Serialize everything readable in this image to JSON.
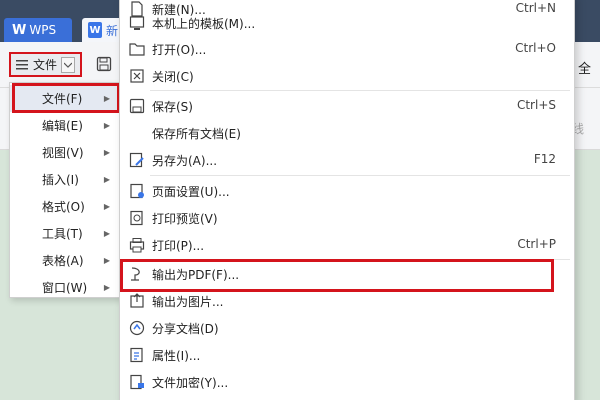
{
  "tabs": {
    "wps_label": "WPS",
    "doc_label": "新"
  },
  "toolbar": {
    "file_label": "文件",
    "right_text": "全",
    "ribbon_right_text": "线"
  },
  "left_menu": {
    "items": [
      {
        "label": "文件(F)"
      },
      {
        "label": "编辑(E)"
      },
      {
        "label": "视图(V)"
      },
      {
        "label": "插入(I)"
      },
      {
        "label": "格式(O)"
      },
      {
        "label": "工具(T)"
      },
      {
        "label": "表格(A)"
      },
      {
        "label": "窗口(W)"
      }
    ]
  },
  "file_menu": {
    "items": [
      {
        "label": "新建(N)...",
        "shortcut": "Ctrl+N",
        "icon": "new-doc-icon"
      },
      {
        "label": "本机上的模板(M)...",
        "shortcut": "",
        "icon": "template-icon"
      },
      {
        "label": "打开(O)...",
        "shortcut": "Ctrl+O",
        "icon": "folder-icon"
      },
      {
        "label": "关闭(C)",
        "shortcut": "",
        "icon": "close-doc-icon"
      },
      {
        "label": "保存(S)",
        "shortcut": "Ctrl+S",
        "icon": "save-icon"
      },
      {
        "label": "保存所有文档(E)",
        "shortcut": "",
        "icon": ""
      },
      {
        "label": "另存为(A)...",
        "shortcut": "F12",
        "icon": "save-as-icon"
      },
      {
        "label": "页面设置(U)...",
        "shortcut": "",
        "icon": "page-setup-icon"
      },
      {
        "label": "打印预览(V)",
        "shortcut": "",
        "icon": "print-preview-icon"
      },
      {
        "label": "打印(P)...",
        "shortcut": "Ctrl+P",
        "icon": "printer-icon"
      },
      {
        "label": "输出为PDF(F)...",
        "shortcut": "",
        "icon": "export-pdf-icon"
      },
      {
        "label": "输出为图片...",
        "shortcut": "",
        "icon": "export-image-icon"
      },
      {
        "label": "分享文档(D)",
        "shortcut": "",
        "icon": "share-icon"
      },
      {
        "label": "属性(I)...",
        "shortcut": "",
        "icon": "properties-icon"
      },
      {
        "label": "文件加密(Y)...",
        "shortcut": "",
        "icon": "encrypt-icon"
      }
    ]
  },
  "colors": {
    "highlight_border": "#d4141c",
    "tabbar": "#3a4b63",
    "wps_tab": "#3a6fd8",
    "background": "#d7e5d9"
  }
}
